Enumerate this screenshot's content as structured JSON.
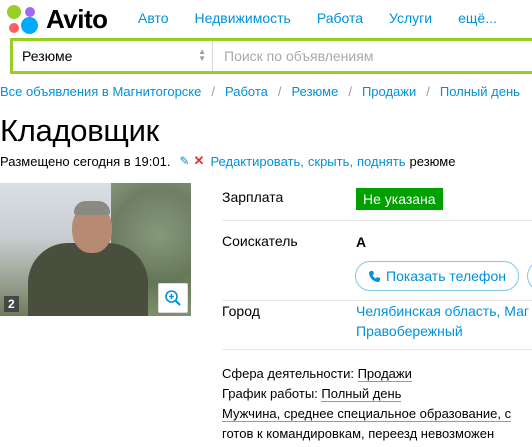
{
  "header": {
    "logo_text": "Avito",
    "nav": [
      "Авто",
      "Недвижимость",
      "Работа",
      "Услуги",
      "ещё..."
    ]
  },
  "search": {
    "category": "Резюме",
    "placeholder": "Поиск по объявлениям"
  },
  "breadcrumbs": [
    "Все объявления в Магнитогорске",
    "Работа",
    "Резюме",
    "Продажи",
    "Полный день"
  ],
  "ad": {
    "title": "Кладовщик",
    "posted": "Размещено сегодня в 19:01.",
    "actions": {
      "edit": "Редактировать",
      "hide": "скрыть",
      "raise": "поднять",
      "suffix": "резюме"
    },
    "photo_count": "2"
  },
  "info": {
    "salary_label": "Зарплата",
    "salary_value": "Не указана",
    "seeker_label": "Соискатель",
    "seeker_value": "А",
    "phone_button": "Показать телефон",
    "city_label": "Город",
    "city_line1": "Челябинская область, Маг",
    "city_line2": "Правобережный"
  },
  "details": {
    "sphere_label": "Сфера деятельности:",
    "sphere_value": "Продажи",
    "schedule_label": "График работы:",
    "schedule_value": "Полный день",
    "profile": "Мужчина, среднее специальное образование, с",
    "travel": "готов к командировкам, переезд невозможен"
  },
  "colors": {
    "accent_blue": "#0091d9",
    "logo_green": "#97cf26",
    "salary_green": "#00a000"
  }
}
